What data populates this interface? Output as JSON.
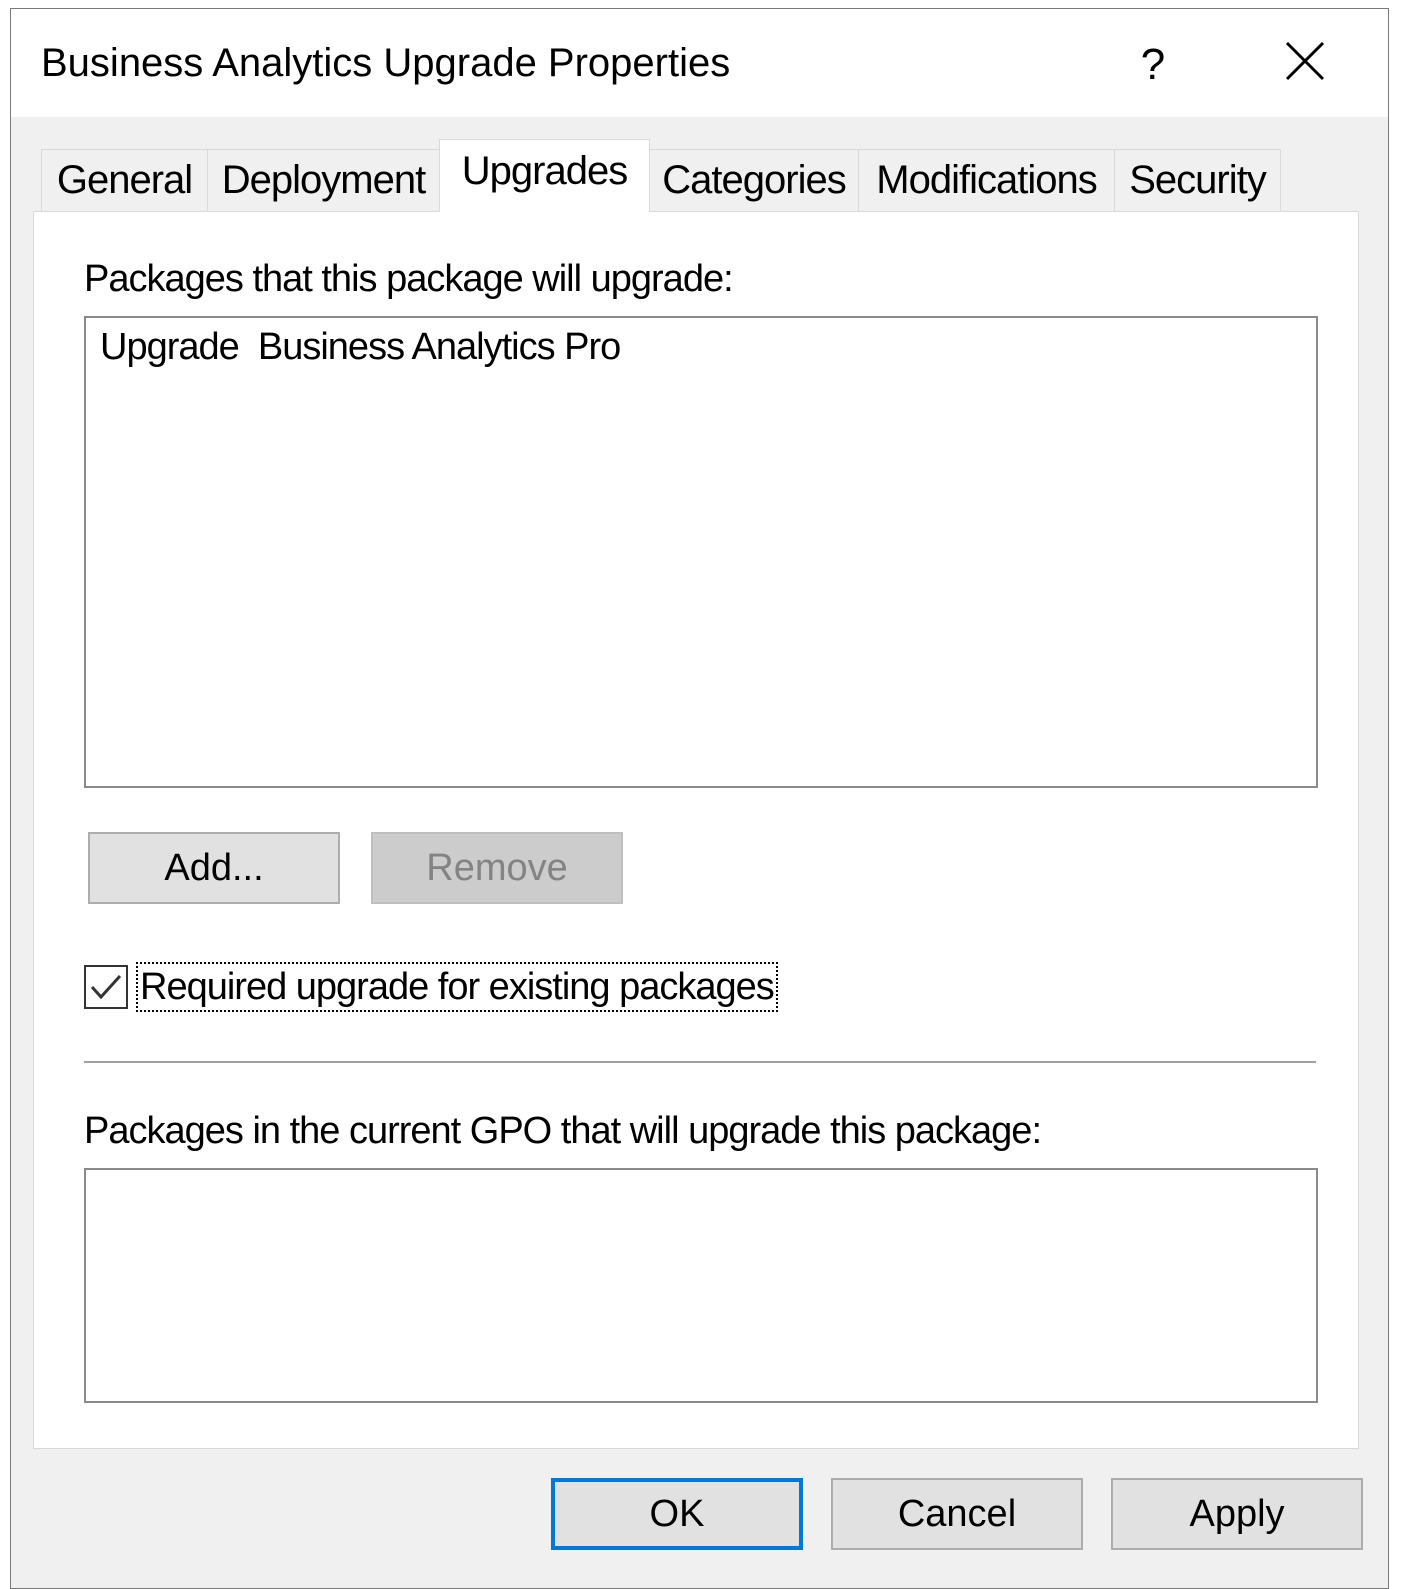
{
  "window": {
    "title": "Business Analytics Upgrade Properties",
    "help_label": "?",
    "close_icon": "close-icon"
  },
  "tabs": [
    {
      "label": "General"
    },
    {
      "label": "Deployment"
    },
    {
      "label": "Upgrades",
      "active": true
    },
    {
      "label": "Categories"
    },
    {
      "label": "Modifications"
    },
    {
      "label": "Security"
    }
  ],
  "upgrades": {
    "upgrades_list_label": "Packages that this package will upgrade:",
    "upgrades_list": [
      {
        "text": "Upgrade  Business Analytics Pro"
      }
    ],
    "add_label": "Add...",
    "remove_label": "Remove",
    "required_label": "Required upgrade for existing packages",
    "required_checked": true,
    "upgraded_by_label": "Packages in the current GPO that will upgrade this package:",
    "upgraded_by_list": []
  },
  "footer": {
    "ok_label": "OK",
    "cancel_label": "Cancel",
    "apply_label": "Apply"
  },
  "colors": {
    "window_bg": "#f0f0f0",
    "panel_bg": "#ffffff",
    "focus_border": "#0078d7",
    "disabled_text": "#838383"
  }
}
